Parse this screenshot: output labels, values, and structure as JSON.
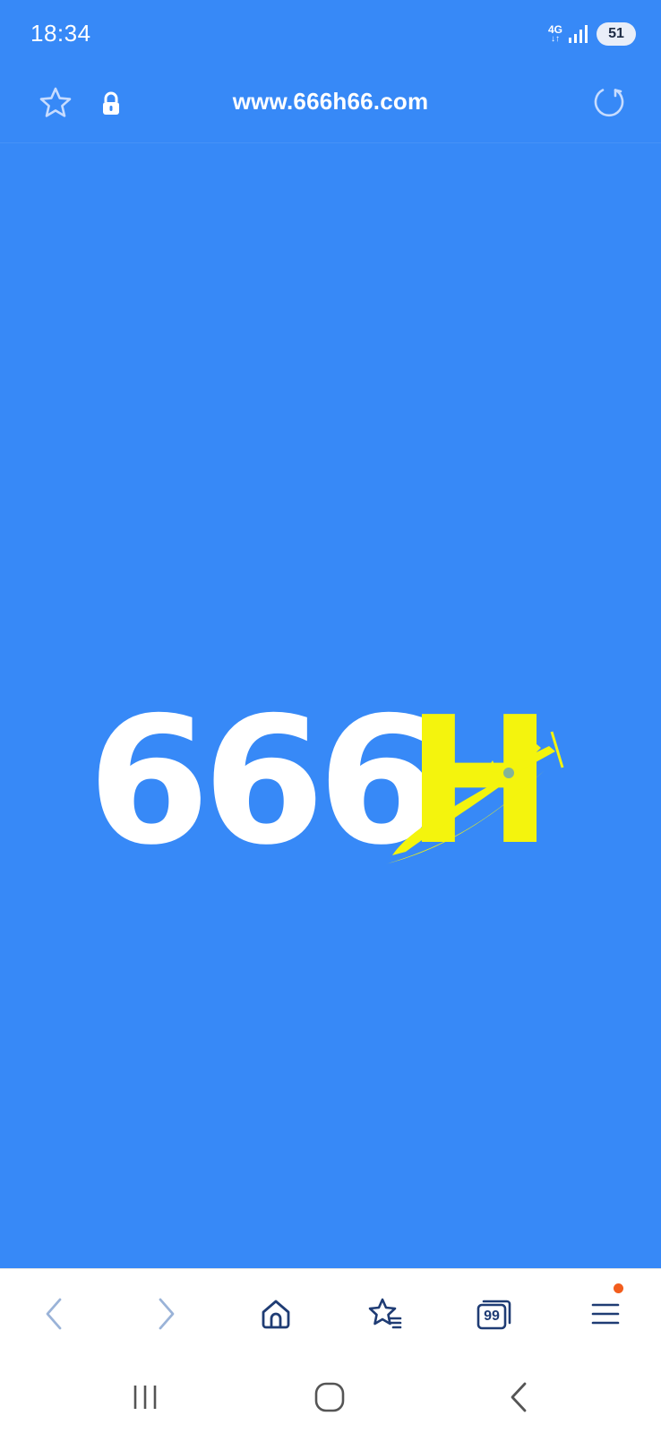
{
  "status_bar": {
    "time": "18:34",
    "network_top": "4G",
    "network_bottom": "↓↑",
    "battery": "51"
  },
  "address_bar": {
    "url": "www.666h66.com",
    "icons": [
      "star-icon",
      "lock-icon",
      "reload-icon"
    ]
  },
  "page": {
    "logo_digits": "666",
    "logo_letter": "H",
    "colors": {
      "background": "#3789f7",
      "digits": "#ffffff",
      "letter": "#f4f40d"
    }
  },
  "toolbar": {
    "tabs_count": "99",
    "icons": [
      "back-icon",
      "forward-icon",
      "home-icon",
      "bookmarks-icon",
      "tabs-icon",
      "menu-icon"
    ],
    "notification_color": "#f25d1d"
  },
  "nav_bar": {
    "icons": [
      "recent-apps-icon",
      "home-nav-icon",
      "back-nav-icon"
    ]
  }
}
